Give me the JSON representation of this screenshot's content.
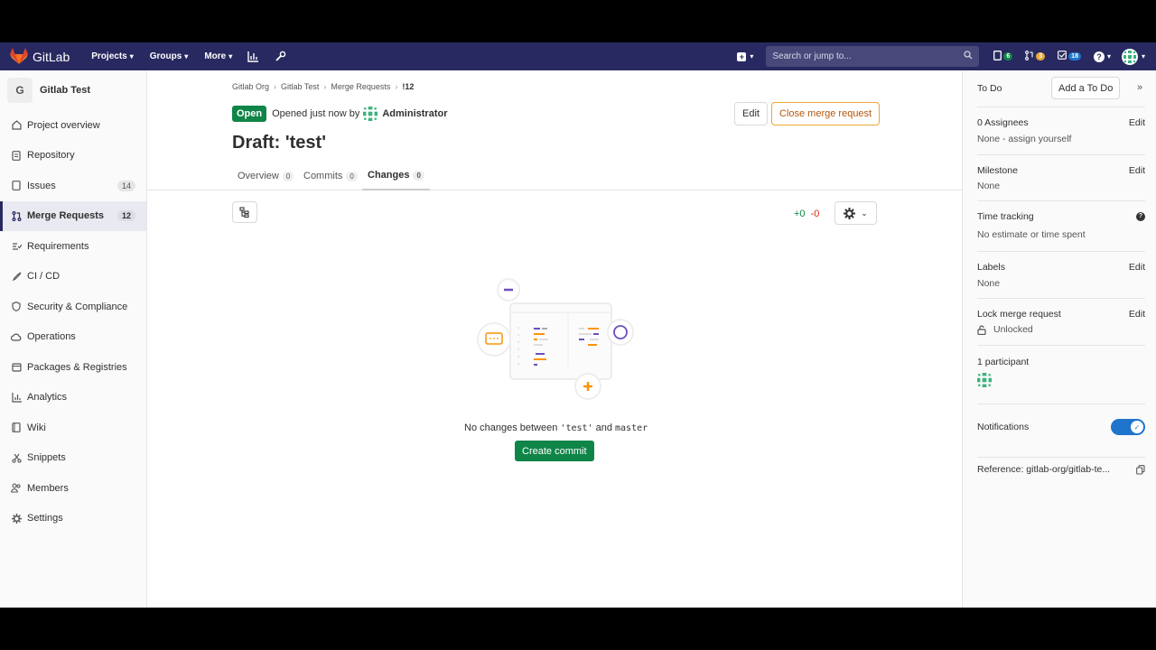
{
  "navbar": {
    "logo_text": "GitLab",
    "menu": [
      {
        "label": "Projects"
      },
      {
        "label": "Groups"
      },
      {
        "label": "More"
      }
    ],
    "search_placeholder": "Search or jump to...",
    "counters": {
      "issues": "6",
      "merge_requests": "3",
      "todos": "18"
    },
    "colors": {
      "bg": "#292961",
      "issues_badge": "#108548",
      "mr_badge": "#e9a837",
      "todo_badge": "#1f75cb"
    }
  },
  "project": {
    "avatar_letter": "G",
    "name": "Gitlab Test"
  },
  "sidebar": {
    "items": [
      {
        "label": "Project overview",
        "icon": "home-icon"
      },
      {
        "label": "Repository",
        "icon": "doc-icon"
      },
      {
        "label": "Issues",
        "icon": "issues-icon",
        "count": "14"
      },
      {
        "label": "Merge Requests",
        "icon": "merge-request-icon",
        "count": "12",
        "active": true
      },
      {
        "label": "Requirements",
        "icon": "requirements-icon"
      },
      {
        "label": "CI / CD",
        "icon": "rocket-icon"
      },
      {
        "label": "Security & Compliance",
        "icon": "shield-icon"
      },
      {
        "label": "Operations",
        "icon": "cloud-icon"
      },
      {
        "label": "Packages & Registries",
        "icon": "package-icon"
      },
      {
        "label": "Analytics",
        "icon": "chart-icon"
      },
      {
        "label": "Wiki",
        "icon": "book-icon"
      },
      {
        "label": "Snippets",
        "icon": "scissors-icon"
      },
      {
        "label": "Members",
        "icon": "users-icon"
      },
      {
        "label": "Settings",
        "icon": "gear-icon"
      }
    ]
  },
  "breadcrumb": [
    "Gitlab Org",
    "Gitlab Test",
    "Merge Requests",
    "!12"
  ],
  "mr": {
    "status": "Open",
    "opened_text": "Opened just now by",
    "author": "Administrator",
    "edit_label": "Edit",
    "close_label": "Close merge request",
    "title": "Draft: 'test'"
  },
  "tabs": [
    {
      "label": "Overview",
      "count": "0"
    },
    {
      "label": "Commits",
      "count": "0"
    },
    {
      "label": "Changes",
      "count": "0",
      "active": true
    }
  ],
  "diffstat": {
    "added": "+0",
    "removed": "-0"
  },
  "empty_state": {
    "prefix": "No changes between ",
    "source": "'test'",
    "middle": " and ",
    "target": "master",
    "button": "Create commit"
  },
  "right_sidebar": {
    "todo_label": "To Do",
    "add_todo": "Add a To Do",
    "assignees": {
      "title": "0 Assignees",
      "edit": "Edit",
      "value": "None - assign yourself"
    },
    "milestone": {
      "title": "Milestone",
      "edit": "Edit",
      "value": "None"
    },
    "time_tracking": {
      "title": "Time tracking",
      "value": "No estimate or time spent"
    },
    "labels": {
      "title": "Labels",
      "edit": "Edit",
      "value": "None"
    },
    "lock": {
      "title": "Lock merge request",
      "edit": "Edit",
      "value": "Unlocked"
    },
    "participants": {
      "title": "1 participant"
    },
    "notifications": {
      "title": "Notifications",
      "enabled": true
    },
    "reference": "Reference: gitlab-org/gitlab-te..."
  }
}
